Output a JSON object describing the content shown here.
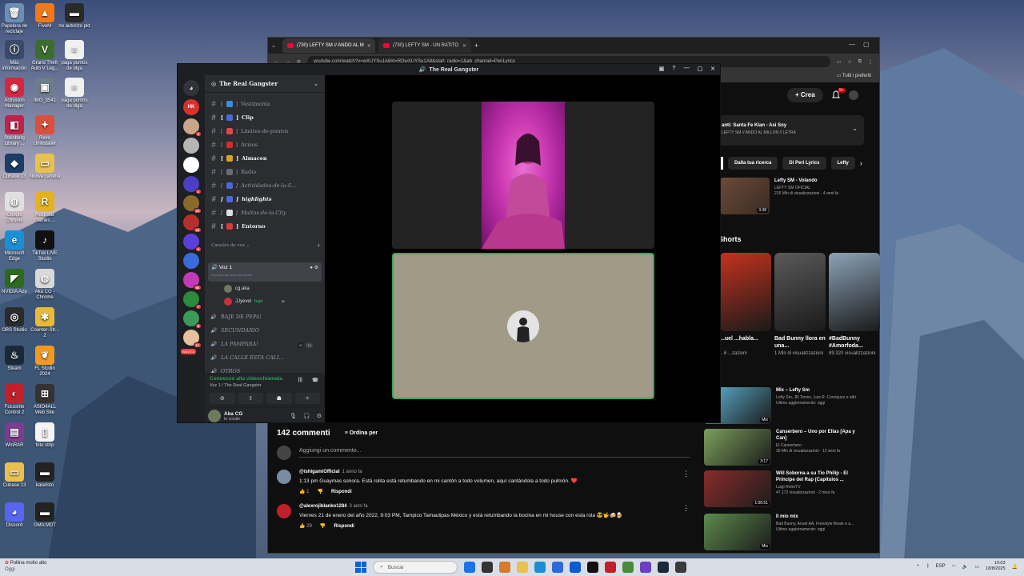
{
  "desktop": {
    "icons": [
      {
        "label": "Papelera de reciclaje",
        "color": "#6c8fb5",
        "glyph": "🗑"
      },
      {
        "label": "FiveM",
        "color": "#f07a1a",
        "glyph": "▲"
      },
      {
        "label": "no autorizo pkt",
        "color": "#2a2a2a",
        "glyph": "▬"
      },
      {
        "label": "Más información",
        "color": "#3a4a6a",
        "glyph": "ⓘ"
      },
      {
        "label": "Grand Theft Auto V Leg...",
        "color": "#3b6e2e",
        "glyph": "V"
      },
      {
        "label": "paga puntos de diga",
        "color": "#f0f0f0",
        "glyph": "≡"
      },
      {
        "label": "Activision Manager",
        "color": "#d7263d",
        "glyph": "◉"
      },
      {
        "label": "IMG_3541",
        "color": "#6c7d8c",
        "glyph": "▣"
      },
      {
        "label": "paga puntos de diga",
        "color": "#f0f0f0",
        "glyph": "≡"
      },
      {
        "label": "Steinberg Library ...",
        "color": "#c0234a",
        "glyph": "◧"
      },
      {
        "label": "Revo Uninstaller",
        "color": "#d9503c",
        "glyph": "✦"
      },
      {
        "label": "Cubase 13",
        "color": "#1e3d66",
        "glyph": "◆"
      },
      {
        "label": "Nuova cartella",
        "color": "#e8c14e",
        "glyph": "▭"
      },
      {
        "label": "Google Chrome",
        "color": "#e0e0e0",
        "glyph": "◍"
      },
      {
        "label": "Rockstar Games ...",
        "color": "#e3b21d",
        "glyph": "R"
      },
      {
        "label": "Microsoft Edge",
        "color": "#1a8fd6",
        "glyph": "e"
      },
      {
        "label": "TikTok LIVE Studio",
        "color": "#111111",
        "glyph": "♪"
      },
      {
        "label": "NVIDIA App",
        "color": "#2d6a1f",
        "glyph": "◤"
      },
      {
        "label": "Aka CG - Chrome",
        "color": "#d9d9d9",
        "glyph": "◍"
      },
      {
        "label": "OBS Studio",
        "color": "#2b2b2b",
        "glyph": "◎"
      },
      {
        "label": "Counter-Str... 2",
        "color": "#e8b93a",
        "glyph": "✱"
      },
      {
        "label": "Steam",
        "color": "#1b2838",
        "glyph": "♨"
      },
      {
        "label": "FL Studio 2024",
        "color": "#f29a1f",
        "glyph": "❦"
      },
      {
        "label": "Focusrite Control 2",
        "color": "#c21f2b",
        "glyph": "◐"
      },
      {
        "label": "ASIO4ALL Web Site",
        "color": "#333333",
        "glyph": "⊞"
      },
      {
        "label": "WinRAR",
        "color": "#7b3d8f",
        "glyph": "▤"
      },
      {
        "label": "foto strip",
        "color": "#f4f4f4",
        "glyph": "▯"
      },
      {
        "label": "Cubase 13",
        "color": "#e8c14e",
        "glyph": "▭"
      },
      {
        "label": "kalaristo",
        "color": "#222222",
        "glyph": "▬"
      },
      {
        "label": "Discord",
        "color": "#5865f2",
        "glyph": "◕"
      },
      {
        "label": "GMA MDT",
        "color": "#222222",
        "glyph": "▬"
      }
    ]
  },
  "chrome": {
    "tabs": [
      "(730) LEFTY SM // ANDO AL M",
      "(730) LEFTY SM - UN RATITO"
    ],
    "url": "youtube.com/watch?v=wXUYSu1A8#t=RDwXUYSu1A8&start_radio=1&ab_channel=PeriLyrics",
    "bookmarks_label": "Tutti i preferiti"
  },
  "youtube": {
    "create_label": "Crea",
    "bell_badge": "9+",
    "mix_panel": {
      "title": "anti: Santa Fe Klan - Asi Soy",
      "subtitle": "LEFTY SM // ANDO AL MILLON // LETRA"
    },
    "chips": [
      "Dalla tua ricerca",
      "Di Peri Lyrics",
      "Lefty"
    ],
    "top_rec": {
      "title": "Lefty SM - Volando",
      "channel": "LEFTY SM OFICIAL",
      "meta": "215 Mln di visualizzazioni · 4 anni fa",
      "duration": "3:38"
    },
    "shorts_label": "Shorts",
    "shorts": [
      {
        "title": "...uel ...habla...",
        "views": "...6 ...zazioni",
        "color": "#c4321d"
      },
      {
        "title": "Bad Bunny llora en una...",
        "views": "1 Mln di visualizzazioni",
        "color": "#5a5a5a"
      },
      {
        "title": "#BadBunny #Amorfoda...",
        "views": "89.320 visualizzazioni",
        "color": "#8ba3b8"
      }
    ],
    "recs": [
      {
        "title": "Mix – Lefty Sm",
        "channel": "Lefty Sm, JR Torres, Luis R. Conriquez e altri",
        "meta": "Ultimo aggiornamento: oggi",
        "duration": "Mix",
        "color": "#5fb5d9"
      },
      {
        "title": "Canserbero – Uno por Ellas [Apa y Can]",
        "channel": "El Canserbero",
        "meta": "30 Mln di visualizzazioni · 12 anni fa",
        "duration": "3:17",
        "color": "#7ba05b"
      },
      {
        "title": "Will Soborna a su Tío Philip - El Príncipe del Rap (Capítulos ...",
        "channel": "Luigi RetroTV",
        "meta": "47.172 visualizzazioni · 2 mesi fa",
        "duration": "1:06:51",
        "color": "#8a2b2b"
      },
      {
        "title": "Il mio mix",
        "channel": "Bad Bunny, Anuel AA, Freestyle Beats e a...",
        "meta": "Ultimo aggiornamento: oggi",
        "duration": "Mix",
        "color": "#5c8a4a"
      }
    ],
    "comments": {
      "count": "142 commenti",
      "sort_label": "Ordina per",
      "add_placeholder": "Aggiungi un commento...",
      "items": [
        {
          "author": "@ishigamiOfficial",
          "age": "1 anno fa",
          "text": "1:13 pm Guaymas sonora. Está rolita está retumbando en mi cantón a todo volumen, aquí cantándola a todo pulmón. ❤️",
          "likes": "1",
          "reply": "Rispondi",
          "color": "#7a8ca3"
        },
        {
          "author": "@alexrojiblanko1284",
          "age": "3 anni fa",
          "text": "Viernes 21 de enero del año 2022, 9:03 PM, Tampico Tamaulipas México y está retumbando la bocina en mi house con esta rola 😎🤟🍻🍺",
          "likes": "29",
          "reply": "Rispondi",
          "color": "#c0202a"
        }
      ]
    }
  },
  "discord": {
    "window_title": "The Real Gangster",
    "guild_name": "The Real Gangster",
    "channels": [
      {
        "name": "Vestimenta",
        "style": "normal",
        "color": "#3b8fd9"
      },
      {
        "name": "Clip",
        "style": "bold",
        "color": "#4b6ad9"
      },
      {
        "name": "Limites-de-puntos",
        "style": "normal",
        "color": "#d94b4b"
      },
      {
        "name": "Avisos",
        "style": "normal",
        "color": "#d92b2b"
      },
      {
        "name": "Almacen",
        "style": "bold",
        "color": "#d9a32b"
      },
      {
        "name": "Radio",
        "style": "normal",
        "color": "#6b6b6b"
      },
      {
        "name": "Actividades-de-la-S...",
        "style": "italic",
        "color": "#4b6ad9"
      },
      {
        "name": "highlights",
        "style": "bolditalic",
        "color": "#4b6ad9"
      },
      {
        "name": "Multas-de-la-City",
        "style": "italic",
        "color": "#e0e0e0"
      },
      {
        "name": "Entorno",
        "style": "bold",
        "color": "#d93b3b"
      }
    ],
    "voice_category": "Canales de voz",
    "voice_active": {
      "name": "Voz 1",
      "status": "Imposta uno stato del canale"
    },
    "voice_users": [
      {
        "name": "cg.aka",
        "color": "#6d7a5e",
        "tag": ""
      },
      {
        "name": "JJyevel",
        "color": "#c9303a",
        "tag": "high"
      }
    ],
    "voice_channels": [
      {
        "name": "BAJE DE PEPA!",
        "style": "normal"
      },
      {
        "name": "SECUNDARIO",
        "style": "italic"
      },
      {
        "name": "LA PAMPARA!",
        "style": "italic"
      },
      {
        "name": "LA CALLE ESTA CALI...",
        "style": "italic"
      },
      {
        "name": "OTROS",
        "style": "italic"
      }
    ],
    "voice_count_badges": [
      "00",
      "15"
    ],
    "servers": [
      {
        "color": "#d9322b",
        "label": "HK",
        "ping": ""
      },
      {
        "color": "#c9a68a",
        "label": "",
        "ping": "3"
      },
      {
        "color": "#b5b5b5",
        "label": "",
        "ping": ""
      },
      {
        "color": "#ffffff",
        "label": "",
        "ping": ""
      },
      {
        "color": "#4b3fc4",
        "label": "",
        "ping": "1"
      },
      {
        "color": "#8a6a2b",
        "label": "",
        "ping": "23"
      },
      {
        "color": "#b5302b",
        "label": "",
        "ping": "23"
      },
      {
        "color": "#5a3fd9",
        "label": "",
        "ping": "6"
      },
      {
        "color": "#3b6ad9",
        "label": "",
        "ping": ""
      },
      {
        "color": "#c23bb5",
        "label": "",
        "ping": "56"
      },
      {
        "color": "#2b8a3b",
        "label": "",
        "ping": "7"
      },
      {
        "color": "#3b9a5a",
        "label": "",
        "ping": "8"
      },
      {
        "color": "#e8c0a0",
        "label": "",
        "ping": "17"
      }
    ],
    "new_label": "NOVITÀ",
    "connection": {
      "status": "Connesso alla videochiamata",
      "where": "Voz 1 / The Real Gangster"
    },
    "user": {
      "name": "Aka CG",
      "status": "In vocale"
    }
  },
  "taskbar": {
    "weather_title": "Pollina molto alto",
    "weather_sub": "Oggi",
    "search_placeholder": "Buscar",
    "lang": "ESP",
    "time": "10:03",
    "date": "18/8/2025",
    "apps": [
      "#1a73e8",
      "#333333",
      "#d97a2b",
      "#e8c14e",
      "#1a8fd6",
      "#2b6bd9",
      "#0a5ad4",
      "#111111",
      "#c21f2b",
      "#4a8a3b",
      "#6b3fc4",
      "#1b2838",
      "#3a3a3a"
    ]
  }
}
